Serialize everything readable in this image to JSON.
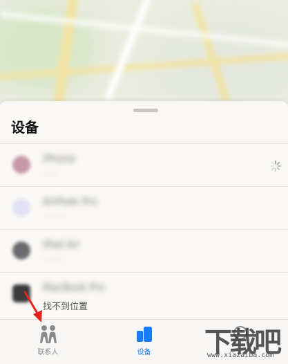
{
  "sheet": {
    "title": "设备",
    "devices": [
      {
        "name": "iPhone",
        "subtitle": "······",
        "icon": "phone-thumb-icon",
        "thumb_color": "#c79aa8",
        "loading": true
      },
      {
        "name": "AirPods Pro",
        "subtitle": "··········",
        "icon": "airpods-thumb-icon",
        "thumb_color": "#dfe2f3",
        "loading": false
      },
      {
        "name": "iPad Air",
        "subtitle": "·········",
        "icon": "ipad-thumb-icon",
        "thumb_color": "#6a6a70",
        "loading": false
      },
      {
        "name": "MacBook Pro",
        "subtitle": "找不到位置",
        "icon": "mac-thumb-icon",
        "thumb_color": "#3b3b3e",
        "loading": false
      }
    ]
  },
  "tabbar": {
    "people_label": "联系人",
    "devices_label": "设备",
    "active": "devices",
    "accent_color": "#1a7cf5"
  },
  "watermark": {
    "text": "下载吧",
    "url": "www.xiazaiba.com"
  }
}
